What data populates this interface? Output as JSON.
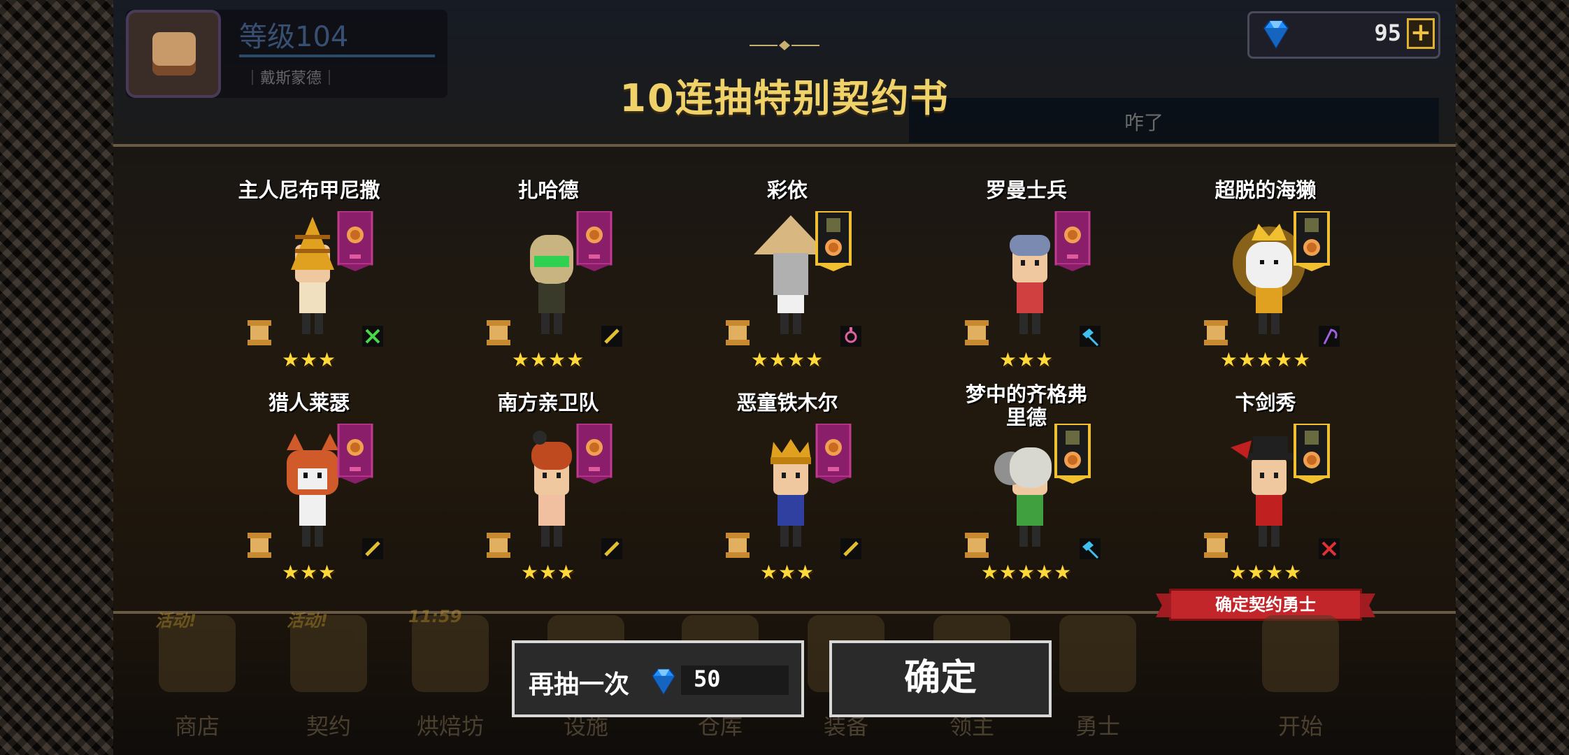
{
  "player": {
    "level": "等级104",
    "name": "｜戴斯蒙德｜"
  },
  "currency": {
    "gems": "95",
    "plus": "+"
  },
  "title": "10连抽特别契约书",
  "chat": {
    "text": "咋了"
  },
  "heroes": [
    {
      "name": "主人尼布甲尼撒",
      "stars": "★★★",
      "rarity": 3,
      "banner": "single",
      "weapon": "cross-icon",
      "weapon_color": "#4ad84a",
      "sprite": "golden-head",
      "colors": [
        "#e0a020",
        "#f0e0c0"
      ]
    },
    {
      "name": "扎哈德",
      "stars": "★★★★",
      "rarity": 4,
      "banner": "single",
      "weapon": "sword-icon",
      "weapon_color": "#e0c030",
      "sprite": "goggles",
      "colors": [
        "#c8b480",
        "#3a3a2a"
      ]
    },
    {
      "name": "彩依",
      "stars": "★★★★",
      "rarity": 4,
      "banner": "double",
      "weapon": "staff-icon",
      "weapon_color": "#e060a0",
      "sprite": "straw-hat",
      "colors": [
        "#d8b880",
        "#f0f0f0"
      ]
    },
    {
      "name": "罗曼士兵",
      "stars": "★★★",
      "rarity": 3,
      "banner": "single",
      "weapon": "axe-icon",
      "weapon_color": "#40c0f0",
      "sprite": "soldier",
      "colors": [
        "#7a8ab0",
        "#d04040"
      ]
    },
    {
      "name": "超脱的海獭",
      "stars": "★★★★★",
      "rarity": 5,
      "banner": "double",
      "weapon": "scythe-icon",
      "weapon_color": "#a060e0",
      "sprite": "otter-king",
      "colors": [
        "#f0f0f0",
        "#e0a020"
      ]
    },
    {
      "name": "猎人莱瑟",
      "stars": "★★★",
      "rarity": 3,
      "banner": "single",
      "weapon": "sword-icon",
      "weapon_color": "#e0c030",
      "sprite": "red-panda",
      "colors": [
        "#d05a2a",
        "#f0f0f0"
      ]
    },
    {
      "name": "南方亲卫队",
      "stars": "★★★",
      "rarity": 3,
      "banner": "single",
      "weapon": "sword-icon",
      "weapon_color": "#e0c030",
      "sprite": "guard",
      "colors": [
        "#c04a20",
        "#f0c0a0"
      ]
    },
    {
      "name": "恶童铁木尔",
      "stars": "★★★",
      "rarity": 3,
      "banner": "single",
      "weapon": "sword-icon",
      "weapon_color": "#e0c030",
      "sprite": "crown-kid",
      "colors": [
        "#e0a020",
        "#3040a0"
      ]
    },
    {
      "name": "梦中的齐格弗里德",
      "stars": "★★★★★",
      "rarity": 5,
      "banner": "double",
      "weapon": "axe-icon",
      "weapon_color": "#40c0f0",
      "sprite": "white-hair",
      "colors": [
        "#d8d8d0",
        "#40a040"
      ]
    },
    {
      "name": "卞剑秀",
      "stars": "★★★★",
      "rarity": 4,
      "banner": "double",
      "weapon": "crossed-swords-icon",
      "weapon_color": "#e03030",
      "sprite": "black-hat",
      "colors": [
        "#202020",
        "#c02020"
      ]
    }
  ],
  "ribbon": "确定契约勇士",
  "nav": [
    {
      "label": "商店",
      "badge": "活动!"
    },
    {
      "label": "契约",
      "badge": "活动!"
    },
    {
      "label": "烘焙坊",
      "badge": "11:59"
    },
    {
      "label": "设施",
      "badge": ""
    },
    {
      "label": "仓库",
      "badge": ""
    },
    {
      "label": "装备",
      "badge": ""
    },
    {
      "label": "领主",
      "badge": ""
    },
    {
      "label": "勇士",
      "badge": ""
    },
    {
      "label": "开始",
      "badge": ""
    }
  ],
  "actions": {
    "again_label": "再抽一次",
    "again_cost": "50",
    "confirm_label": "确定"
  },
  "colors": {
    "gold": "#f0d26a",
    "star": "#ffd83a",
    "banner": "#8a1e6a",
    "ribbon": "#c3262a"
  }
}
